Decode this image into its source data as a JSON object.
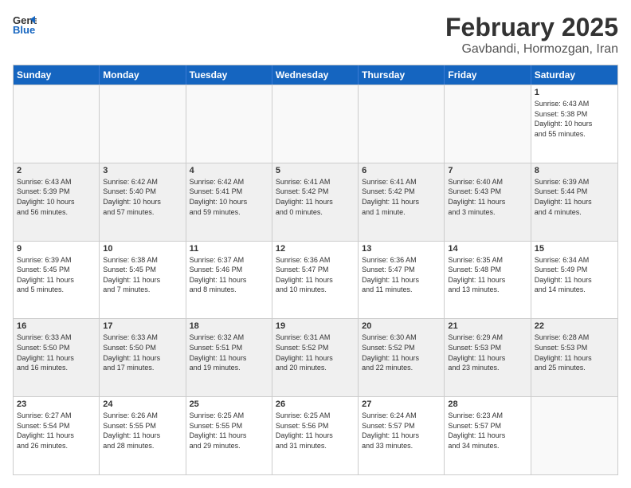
{
  "header": {
    "logo_line1": "General",
    "logo_line2": "Blue",
    "month": "February 2025",
    "location": "Gavbandi, Hormozgan, Iran"
  },
  "weekdays": [
    "Sunday",
    "Monday",
    "Tuesday",
    "Wednesday",
    "Thursday",
    "Friday",
    "Saturday"
  ],
  "rows": [
    [
      {
        "day": "",
        "info": "",
        "empty": true
      },
      {
        "day": "",
        "info": "",
        "empty": true
      },
      {
        "day": "",
        "info": "",
        "empty": true
      },
      {
        "day": "",
        "info": "",
        "empty": true
      },
      {
        "day": "",
        "info": "",
        "empty": true
      },
      {
        "day": "",
        "info": "",
        "empty": true
      },
      {
        "day": "1",
        "info": "Sunrise: 6:43 AM\nSunset: 5:38 PM\nDaylight: 10 hours\nand 55 minutes.",
        "empty": false
      }
    ],
    [
      {
        "day": "2",
        "info": "Sunrise: 6:43 AM\nSunset: 5:39 PM\nDaylight: 10 hours\nand 56 minutes.",
        "empty": false
      },
      {
        "day": "3",
        "info": "Sunrise: 6:42 AM\nSunset: 5:40 PM\nDaylight: 10 hours\nand 57 minutes.",
        "empty": false
      },
      {
        "day": "4",
        "info": "Sunrise: 6:42 AM\nSunset: 5:41 PM\nDaylight: 10 hours\nand 59 minutes.",
        "empty": false
      },
      {
        "day": "5",
        "info": "Sunrise: 6:41 AM\nSunset: 5:42 PM\nDaylight: 11 hours\nand 0 minutes.",
        "empty": false
      },
      {
        "day": "6",
        "info": "Sunrise: 6:41 AM\nSunset: 5:42 PM\nDaylight: 11 hours\nand 1 minute.",
        "empty": false
      },
      {
        "day": "7",
        "info": "Sunrise: 6:40 AM\nSunset: 5:43 PM\nDaylight: 11 hours\nand 3 minutes.",
        "empty": false
      },
      {
        "day": "8",
        "info": "Sunrise: 6:39 AM\nSunset: 5:44 PM\nDaylight: 11 hours\nand 4 minutes.",
        "empty": false
      }
    ],
    [
      {
        "day": "9",
        "info": "Sunrise: 6:39 AM\nSunset: 5:45 PM\nDaylight: 11 hours\nand 5 minutes.",
        "empty": false
      },
      {
        "day": "10",
        "info": "Sunrise: 6:38 AM\nSunset: 5:45 PM\nDaylight: 11 hours\nand 7 minutes.",
        "empty": false
      },
      {
        "day": "11",
        "info": "Sunrise: 6:37 AM\nSunset: 5:46 PM\nDaylight: 11 hours\nand 8 minutes.",
        "empty": false
      },
      {
        "day": "12",
        "info": "Sunrise: 6:36 AM\nSunset: 5:47 PM\nDaylight: 11 hours\nand 10 minutes.",
        "empty": false
      },
      {
        "day": "13",
        "info": "Sunrise: 6:36 AM\nSunset: 5:47 PM\nDaylight: 11 hours\nand 11 minutes.",
        "empty": false
      },
      {
        "day": "14",
        "info": "Sunrise: 6:35 AM\nSunset: 5:48 PM\nDaylight: 11 hours\nand 13 minutes.",
        "empty": false
      },
      {
        "day": "15",
        "info": "Sunrise: 6:34 AM\nSunset: 5:49 PM\nDaylight: 11 hours\nand 14 minutes.",
        "empty": false
      }
    ],
    [
      {
        "day": "16",
        "info": "Sunrise: 6:33 AM\nSunset: 5:50 PM\nDaylight: 11 hours\nand 16 minutes.",
        "empty": false
      },
      {
        "day": "17",
        "info": "Sunrise: 6:33 AM\nSunset: 5:50 PM\nDaylight: 11 hours\nand 17 minutes.",
        "empty": false
      },
      {
        "day": "18",
        "info": "Sunrise: 6:32 AM\nSunset: 5:51 PM\nDaylight: 11 hours\nand 19 minutes.",
        "empty": false
      },
      {
        "day": "19",
        "info": "Sunrise: 6:31 AM\nSunset: 5:52 PM\nDaylight: 11 hours\nand 20 minutes.",
        "empty": false
      },
      {
        "day": "20",
        "info": "Sunrise: 6:30 AM\nSunset: 5:52 PM\nDaylight: 11 hours\nand 22 minutes.",
        "empty": false
      },
      {
        "day": "21",
        "info": "Sunrise: 6:29 AM\nSunset: 5:53 PM\nDaylight: 11 hours\nand 23 minutes.",
        "empty": false
      },
      {
        "day": "22",
        "info": "Sunrise: 6:28 AM\nSunset: 5:53 PM\nDaylight: 11 hours\nand 25 minutes.",
        "empty": false
      }
    ],
    [
      {
        "day": "23",
        "info": "Sunrise: 6:27 AM\nSunset: 5:54 PM\nDaylight: 11 hours\nand 26 minutes.",
        "empty": false
      },
      {
        "day": "24",
        "info": "Sunrise: 6:26 AM\nSunset: 5:55 PM\nDaylight: 11 hours\nand 28 minutes.",
        "empty": false
      },
      {
        "day": "25",
        "info": "Sunrise: 6:25 AM\nSunset: 5:55 PM\nDaylight: 11 hours\nand 29 minutes.",
        "empty": false
      },
      {
        "day": "26",
        "info": "Sunrise: 6:25 AM\nSunset: 5:56 PM\nDaylight: 11 hours\nand 31 minutes.",
        "empty": false
      },
      {
        "day": "27",
        "info": "Sunrise: 6:24 AM\nSunset: 5:57 PM\nDaylight: 11 hours\nand 33 minutes.",
        "empty": false
      },
      {
        "day": "28",
        "info": "Sunrise: 6:23 AM\nSunset: 5:57 PM\nDaylight: 11 hours\nand 34 minutes.",
        "empty": false
      },
      {
        "day": "",
        "info": "",
        "empty": true
      }
    ]
  ]
}
